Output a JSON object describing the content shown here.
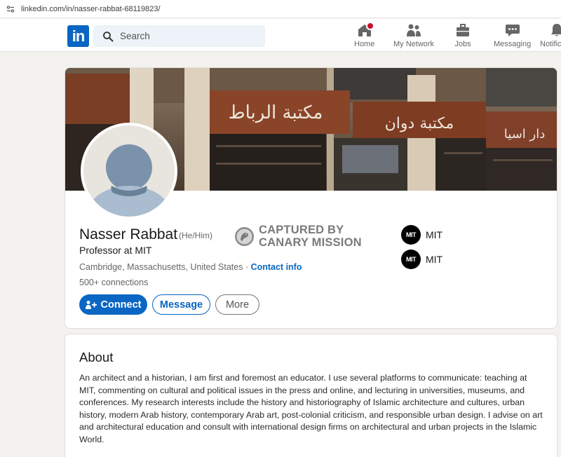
{
  "browser": {
    "url": "linkedin.com/in/nasser-rabbat-68119823/"
  },
  "nav": {
    "logo_text": "in",
    "search_placeholder": "Search",
    "items": [
      {
        "label": "Home",
        "icon": "home-icon"
      },
      {
        "label": "My Network",
        "icon": "people-icon"
      },
      {
        "label": "Jobs",
        "icon": "briefcase-icon"
      },
      {
        "label": "Messaging",
        "icon": "chat-icon"
      },
      {
        "label": "Notific",
        "icon": "bell-icon"
      }
    ]
  },
  "profile": {
    "name": "Nasser Rabbat",
    "pronouns": "(He/Him)",
    "headline": "Professor at MIT",
    "location": "Cambridge, Massachusetts, United States",
    "separator": " · ",
    "contact_label": "Contact info",
    "connections": "500+ connections",
    "buttons": {
      "connect": "Connect",
      "message": "Message",
      "more": "More"
    },
    "stamp": {
      "line1": "CAPTURED BY",
      "line2": "CANARY MISSION"
    },
    "experience": [
      {
        "logo": "MIT",
        "name": "MIT"
      },
      {
        "logo": "MIT",
        "name": "MIT"
      }
    ]
  },
  "about": {
    "title": "About",
    "text": "An architect and a historian, I am first and foremost an educator. I use several platforms to communicate: teaching at MIT, commenting on cultural and political issues in the press and online, and lecturing in universities, museums, and conferences. My research interests include the history and historiography of Islamic architecture and cultures, urban history, modern Arab history, contemporary Arab art, post-colonial criticism, and responsible urban design. I advise on art and architectural education and consult with international design firms on architectural and urban projects in the Islamic World."
  },
  "colors": {
    "brand": "#0a66c2",
    "notification": "#cb112d",
    "page_bg": "#f4f2ee"
  }
}
